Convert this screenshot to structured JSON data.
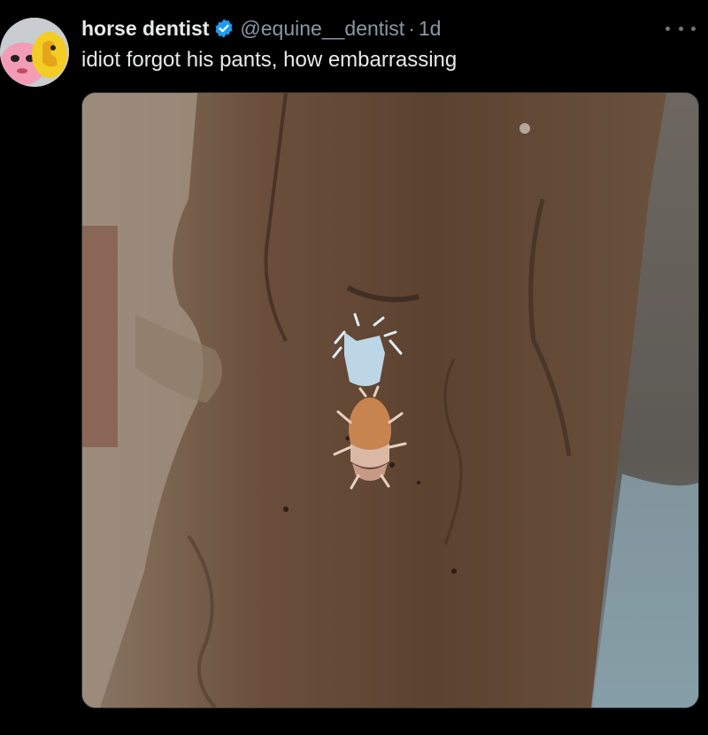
{
  "tweet": {
    "display_name": "horse dentist",
    "verified_icon": "verified-badge-icon",
    "handle": "@equine__dentist",
    "separator": "·",
    "timestamp": "1d",
    "text": "idiot forgot his pants, how embarrassing",
    "more_icon": "more-options-icon",
    "avatar_icon": "avatar-cartoon-characters",
    "media_description_icon": "photo-isopod-on-bark"
  },
  "colors": {
    "background": "#000000",
    "primary_text": "#e7e9ea",
    "secondary_text": "#8b98a5",
    "verified_blue": "#1d9bf0"
  }
}
